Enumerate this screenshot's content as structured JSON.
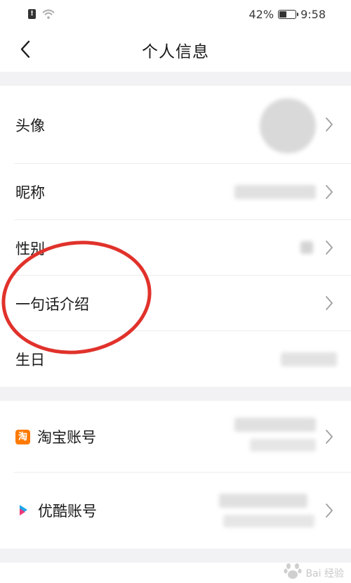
{
  "status_bar": {
    "battery": "42%",
    "time": "9:58",
    "sim_glyph": "!"
  },
  "header": {
    "title": "个人信息",
    "back_icon": "chevron-left-icon"
  },
  "profile_rows": [
    {
      "label": "头像"
    },
    {
      "label": "昵称"
    },
    {
      "label": "性别"
    },
    {
      "label": "一句话介绍"
    },
    {
      "label": "生日"
    }
  ],
  "account_rows": [
    {
      "label": "淘宝账号",
      "icon": "taobao-icon",
      "icon_glyph": "淘"
    },
    {
      "label": "优酷账号",
      "icon": "youku-icon"
    }
  ],
  "colors": {
    "highlight_ring": "#e0322b",
    "taobao_brand": "#ff7a00",
    "section_gap": "#f2f2f4"
  },
  "watermark": {
    "text": "Bai 经验"
  }
}
